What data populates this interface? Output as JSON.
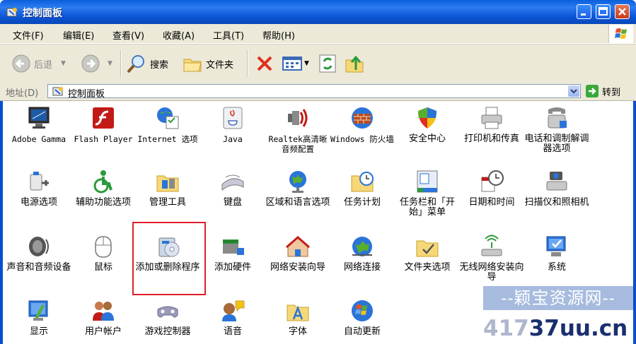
{
  "window": {
    "title": "控制面板"
  },
  "menu": [
    "文件(F)",
    "编辑(E)",
    "查看(V)",
    "收藏(A)",
    "工具(T)",
    "帮助(H)"
  ],
  "toolbar": {
    "back": "后退",
    "search": "搜索",
    "folders": "文件夹"
  },
  "address": {
    "label": "地址(D)",
    "value": "控制面板",
    "go": "转到"
  },
  "items": [
    {
      "label": "Adobe Gamma",
      "icon": "monitor-icon",
      "mono": true
    },
    {
      "label": "Flash Player",
      "icon": "flash-icon",
      "mono": true
    },
    {
      "label": "Internet 选项",
      "icon": "internet-options-icon",
      "mono": true
    },
    {
      "label": "Java",
      "icon": "java-icon",
      "mono": true
    },
    {
      "label": "Realtek高清晰音频配置",
      "icon": "speaker-icon",
      "mono": true
    },
    {
      "label": "Windows 防火墙",
      "icon": "firewall-icon",
      "mono": true
    },
    {
      "label": "安全中心",
      "icon": "shield-icon"
    },
    {
      "label": "打印机和传真",
      "icon": "printer-icon"
    },
    {
      "label": "电话和调制解调器选项",
      "icon": "phone-icon"
    },
    {
      "label": "电源选项",
      "icon": "power-icon"
    },
    {
      "label": "辅助功能选项",
      "icon": "accessibility-icon"
    },
    {
      "label": "管理工具",
      "icon": "admin-tools-icon"
    },
    {
      "label": "键盘",
      "icon": "keyboard-icon"
    },
    {
      "label": "区域和语言选项",
      "icon": "globe-icon"
    },
    {
      "label": "任务计划",
      "icon": "scheduled-tasks-icon"
    },
    {
      "label": "任务栏和「开始」菜单",
      "icon": "taskbar-icon"
    },
    {
      "label": "日期和时间",
      "icon": "clock-icon"
    },
    {
      "label": "扫描仪和照相机",
      "icon": "scanner-icon"
    },
    {
      "label": "声音和音频设备",
      "icon": "sound-icon"
    },
    {
      "label": "鼠标",
      "icon": "mouse-icon"
    },
    {
      "label": "添加或删除程序",
      "icon": "add-remove-programs-icon"
    },
    {
      "label": "添加硬件",
      "icon": "add-hardware-icon"
    },
    {
      "label": "网络安装向导",
      "icon": "network-wizard-icon"
    },
    {
      "label": "网络连接",
      "icon": "network-connections-icon"
    },
    {
      "label": "文件夹选项",
      "icon": "folder-options-icon"
    },
    {
      "label": "无线网络安装向导",
      "icon": "wireless-icon"
    },
    {
      "label": "系统",
      "icon": "system-icon"
    },
    {
      "label": "显示",
      "icon": "display-icon"
    },
    {
      "label": "用户帐户",
      "icon": "users-icon"
    },
    {
      "label": "游戏控制器",
      "icon": "gamepad-icon"
    },
    {
      "label": "语音",
      "icon": "speech-icon"
    },
    {
      "label": "字体",
      "icon": "fonts-icon"
    },
    {
      "label": "自动更新",
      "icon": "windows-update-icon"
    }
  ],
  "watermark": {
    "line1": "--颖宝资源网--",
    "line2a": "417",
    "line2b": "37uu.cn"
  }
}
